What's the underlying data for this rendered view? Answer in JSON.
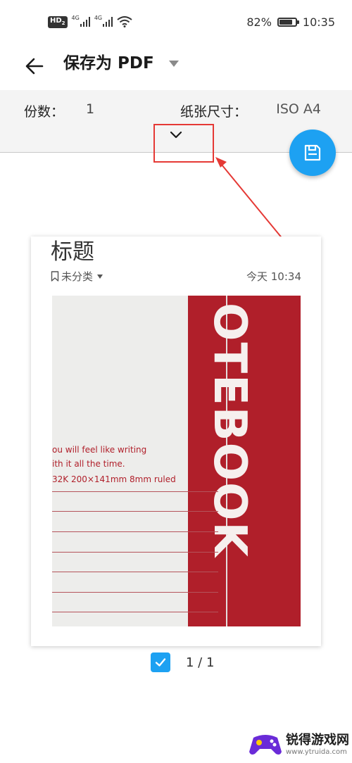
{
  "status_bar": {
    "hd": "HD",
    "hd_sub": "2",
    "net1": "4G",
    "net2": "4G",
    "battery_percent": "82%",
    "battery_level": 0.82,
    "time": "10:35"
  },
  "header": {
    "title": "保存为 PDF"
  },
  "options": {
    "copies_label": "份数：",
    "copies_value": "1",
    "paper_label": "纸张尺寸：",
    "paper_value": "ISO A4"
  },
  "preview": {
    "note_title": "标题",
    "category": "未分类",
    "time": "今天 10:34",
    "photo_text": {
      "line1": "ou will feel like writing",
      "line2": "ith it all the time.",
      "line3": "32K  200×141mm  8mm ruled",
      "brand": "OTEBOOK"
    }
  },
  "pager": {
    "count": "1 / 1",
    "checked": true
  },
  "watermark": {
    "name": "锐得游戏网",
    "url": "www.ytruida.com"
  },
  "colors": {
    "accent": "#1da1f2",
    "annotation": "#e53935",
    "notebook_red": "#b01f2a"
  },
  "icons": {
    "back": "arrow-left-icon",
    "dropdown": "caret-down-icon",
    "expand": "chevron-down-icon",
    "save": "floppy-disk-icon",
    "category": "bookmark-icon",
    "check": "check-icon"
  }
}
